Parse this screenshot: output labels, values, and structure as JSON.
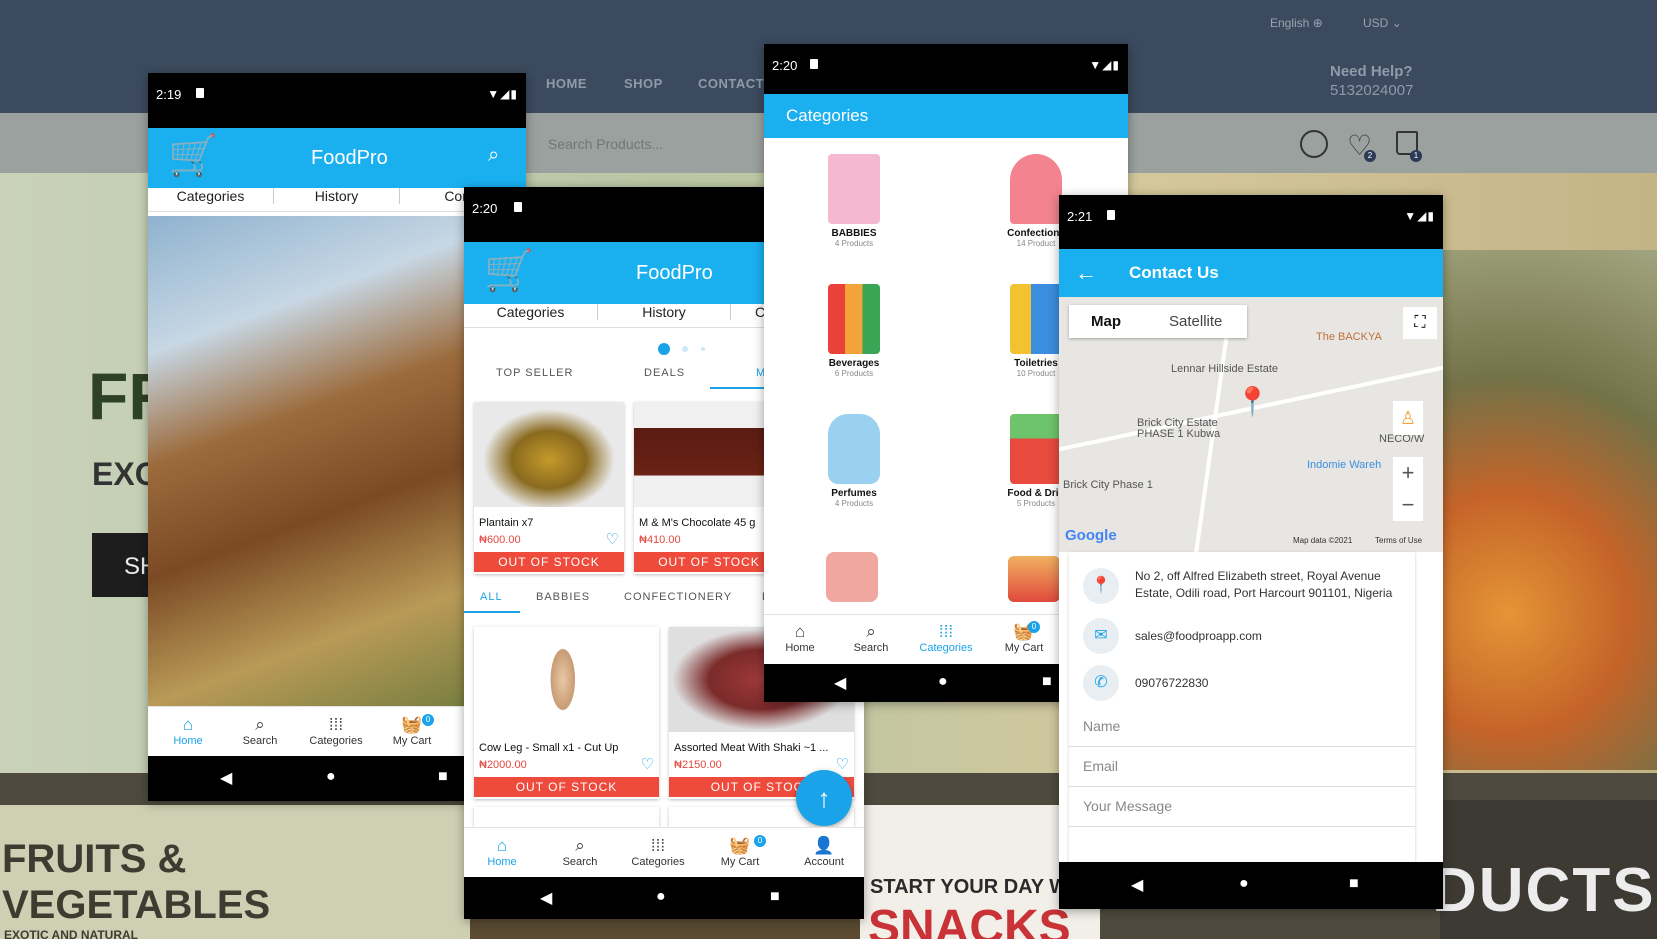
{
  "site": {
    "lang": "English",
    "currency": "USD",
    "nav": [
      "HOME",
      "SHOP",
      "CONTACT"
    ],
    "help_title": "Need Help?",
    "help_phone": "5132024007",
    "search_placeholder": "Search Products...",
    "wishlist_count": "2",
    "cart_count": "1",
    "hero_fr": "FR",
    "hero_exo": "EXO",
    "hero_sh": "SH",
    "fruits_line1": "FRUITS &",
    "fruits_line2": "VEGETABLES",
    "fruits_line3": "EXOTIC AND NATURAL",
    "start_day": "START YOUR DAY W",
    "snacks": "SNACKS",
    "products_partial": "DUCTS"
  },
  "phone1": {
    "time": "2:19",
    "title": "FoodPro",
    "tabs": [
      "Categories",
      "History",
      "Conta"
    ],
    "bottom": [
      "Home",
      "Search",
      "Categories",
      "My Cart"
    ],
    "cart_badge": "0"
  },
  "phone2": {
    "time": "2:20",
    "title": "FoodPro",
    "tabs": [
      "Categories",
      "History",
      "C"
    ],
    "segments": [
      "TOP SELLER",
      "DEALS",
      "M"
    ],
    "cat_tabs": [
      "ALL",
      "BABBIES",
      "CONFECTIONERY",
      "E"
    ],
    "products_top": [
      {
        "name": "Plantain x7",
        "price": "₦600.00",
        "status": "OUT OF STOCK"
      },
      {
        "name": "M & M's Chocolate 45 g",
        "price": "₦410.00",
        "status": "OUT OF STOCK"
      }
    ],
    "products_bottom": [
      {
        "name": "Cow Leg - Small x1 - Cut Up",
        "price": "₦2000.00",
        "status": "OUT OF STOCK"
      },
      {
        "name": "Assorted Meat With Shaki ~1 ...",
        "price": "₦2150.00",
        "status": "OUT OF STOCK"
      }
    ],
    "bottom": [
      "Home",
      "Search",
      "Categories",
      "My Cart",
      "Account"
    ],
    "cart_badge": "0"
  },
  "phone3": {
    "time": "2:20",
    "title": "Categories",
    "categories": [
      {
        "name": "BABBIES",
        "count": "4 Products",
        "color": "#f4b8d0"
      },
      {
        "name": "Confectione",
        "count": "14 Product",
        "color": "#f2838f"
      },
      {
        "name": "Beverages",
        "count": "6 Products",
        "color": "#d9483b"
      },
      {
        "name": "Toiletries",
        "count": "10 Product",
        "color": "#3b8ee0"
      },
      {
        "name": "Perfumes",
        "count": "4 Products",
        "color": "#9ad0f0"
      },
      {
        "name": "Food & Drin",
        "count": "5 Products",
        "color": "#e84a3e"
      }
    ],
    "bottom": [
      "Home",
      "Search",
      "Categories",
      "My Cart"
    ],
    "cart_badge": "0"
  },
  "phone4": {
    "time": "2:21",
    "title": "Contact Us",
    "map_tabs": [
      "Map",
      "Satellite"
    ],
    "map_labels": {
      "backyard": "The BACKYA",
      "lennar": "Lennar Hillside Estate",
      "brick_estate": "Brick City Estate",
      "brick_phase": "PHASE 1 Kubwa",
      "neco": "NECO/W",
      "indomie": "Indomie Wareh",
      "brick_city": "Brick City Phase 1",
      "google": "Google",
      "map_data": "Map data ©2021",
      "terms": "Terms of Use"
    },
    "address": "No 2, off Alfred Elizabeth street, Royal Avenue Estate, Odili road, Port Harcourt 901101, Nigeria",
    "email": "sales@foodproapp.com",
    "phone": "09076722830",
    "fields": {
      "name": "Name",
      "email": "Email",
      "message": "Your Message"
    }
  }
}
